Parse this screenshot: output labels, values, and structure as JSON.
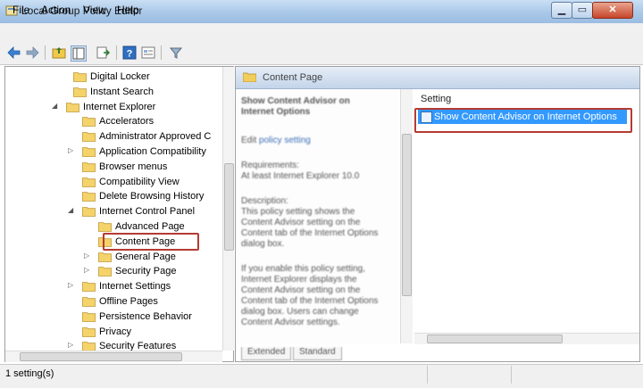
{
  "window": {
    "title": "Local Group Policy Editor"
  },
  "menu": [
    "File",
    "Action",
    "View",
    "Help"
  ],
  "toolbar": {
    "icons": [
      "back-arrow-icon",
      "forward-arrow-icon",
      "up-folder-icon",
      "show-hide-tree-icon",
      "export-list-icon",
      "help-icon",
      "properties-icon",
      "filter-icon"
    ]
  },
  "tree": {
    "items": [
      {
        "label": "Digital Locker",
        "expander": ""
      },
      {
        "label": "Instant Search",
        "expander": ""
      },
      {
        "label": "Internet Explorer",
        "expander": "◢"
      },
      {
        "label": "Accelerators",
        "expander": ""
      },
      {
        "label": "Administrator Approved C",
        "expander": ""
      },
      {
        "label": "Application Compatibility",
        "expander": "▷"
      },
      {
        "label": "Browser menus",
        "expander": ""
      },
      {
        "label": "Compatibility View",
        "expander": ""
      },
      {
        "label": "Delete Browsing History",
        "expander": ""
      },
      {
        "label": "Internet Control Panel",
        "expander": "◢"
      },
      {
        "label": "Advanced Page",
        "expander": ""
      },
      {
        "label": "Content Page",
        "expander": ""
      },
      {
        "label": "General Page",
        "expander": "▷"
      },
      {
        "label": "Security Page",
        "expander": "▷"
      },
      {
        "label": "Internet Settings",
        "expander": "▷"
      },
      {
        "label": "Offline Pages",
        "expander": ""
      },
      {
        "label": "Persistence Behavior",
        "expander": ""
      },
      {
        "label": "Privacy",
        "expander": ""
      },
      {
        "label": "Security Features",
        "expander": "▷"
      }
    ]
  },
  "right_pane": {
    "header": "Content Page",
    "description": {
      "title": "Show Content Advisor on Internet Options",
      "edit_prefix": "Edit",
      "edit_link": "policy setting",
      "requirements_label": "Requirements:",
      "requirements_value": "At least Internet Explorer 10.0",
      "description_label": "Description:",
      "description_text": "This policy setting shows the Content Advisor setting on the Content tab of the Internet Options dialog box.",
      "more_text": "If you enable this policy setting, Internet Explorer displays the Content Advisor setting on the Content tab of the Internet Options dialog box. Users can change Content Advisor settings."
    },
    "setting_column": "Setting",
    "selected_setting": "Show Content Advisor on Internet Options",
    "tabs": [
      "Extended",
      "Standard"
    ]
  },
  "status": {
    "text": "1 setting(s)"
  }
}
